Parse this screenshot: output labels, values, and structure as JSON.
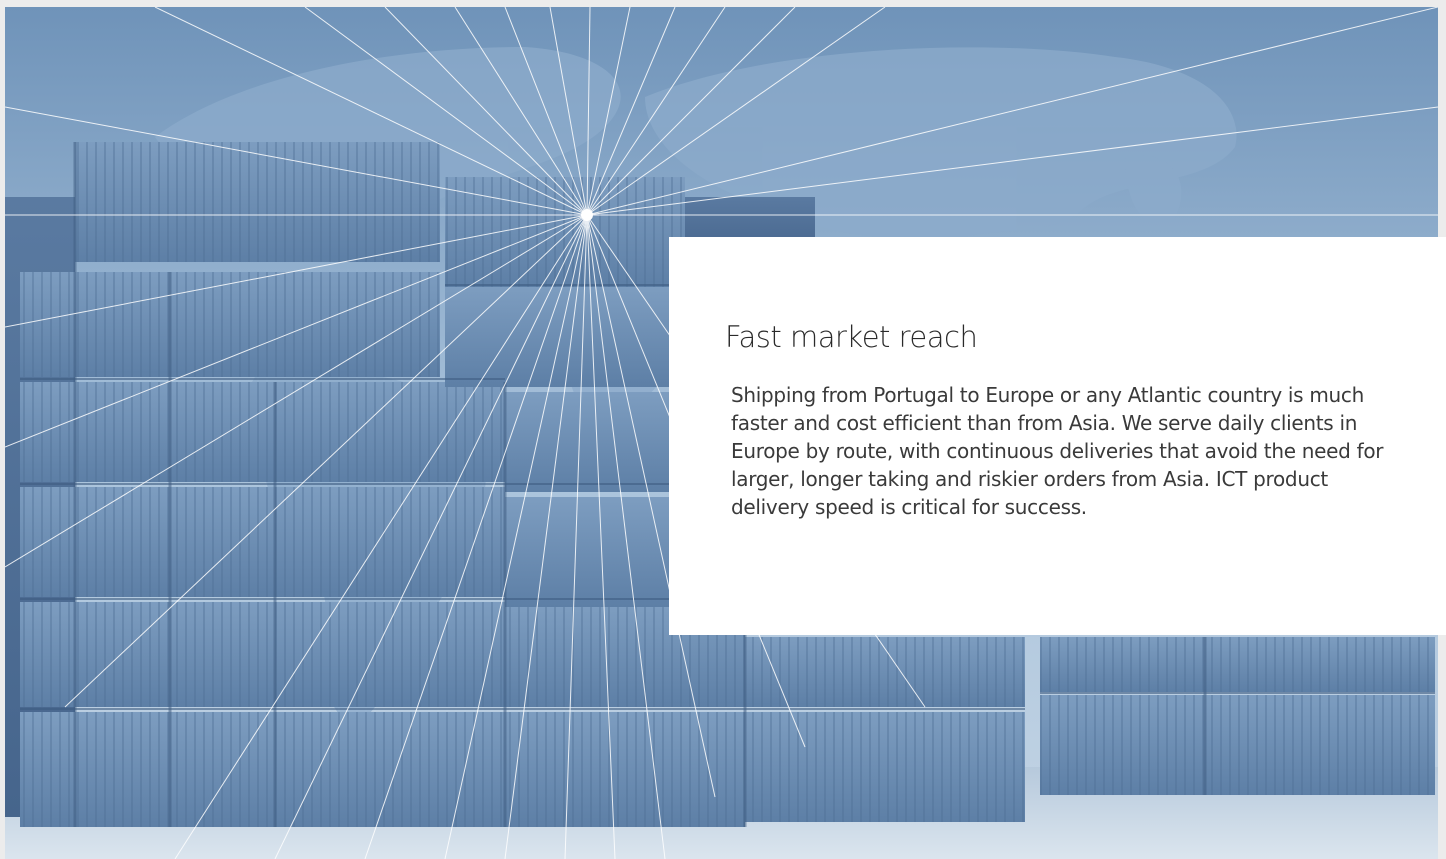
{
  "card": {
    "title": "Fast market reach",
    "body": "Shipping from Portugal to Europe or any Atlantic country is much faster and cost efficient than from Asia. We serve daily clients in Europe by route, with continuous deliveries that avoid the need for larger, longer taking and riskier orders from Asia. ICT product delivery speed is critical for success."
  },
  "hero": {
    "image_subject": "shipping-containers-world-map",
    "tint_color": "#7fa2c6",
    "card_color": "#ffffff"
  }
}
